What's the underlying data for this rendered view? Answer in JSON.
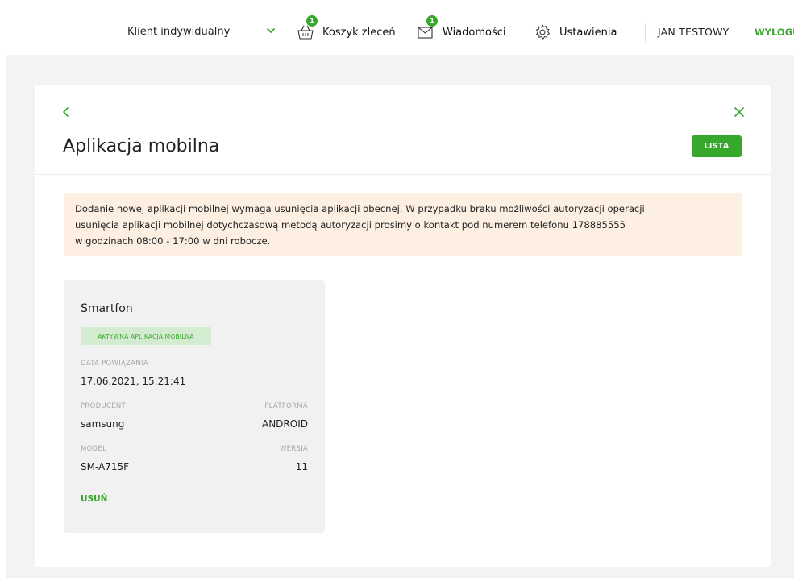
{
  "header": {
    "client_type": "Klient indywidualny",
    "basket_label": "Koszyk zleceń",
    "basket_count": "1",
    "messages_label": "Wiadomości",
    "messages_count": "1",
    "settings_label": "Ustawienia",
    "user_name": "JAN TESTOWY",
    "logout_label": "WYLOGUJ"
  },
  "page": {
    "title": "Aplikacja mobilna",
    "list_button": "LISTA",
    "notice_lines": [
      "Dodanie nowej aplikacji mobilnej wymaga usunięcia aplikacji obecnej. W przypadku braku możliwości autoryzacji operacji",
      "usunięcia aplikacji mobilnej dotychczasową metodą autoryzacji prosimy o kontakt pod numerem telefonu 178885555",
      "w godzinach 08:00 - 17:00 w dni robocze."
    ]
  },
  "device": {
    "name": "Smartfon",
    "status": "AKTYWNA APLIKACJA MOBILNA",
    "link_date_label": "DATA POWIĄZANIA",
    "link_date": "17.06.2021, 15:21:41",
    "producer_label": "PRODUCENT",
    "producer": "samsung",
    "platform_label": "PLATFORMA",
    "platform": "ANDROID",
    "model_label": "MODEL",
    "model": "SM-A715F",
    "version_label": "WERSJA",
    "version": "11",
    "remove_label": "USUŃ"
  },
  "colors": {
    "accent": "#38a82c",
    "notice_bg": "#fdf0e2",
    "badge_bg": "#d3ecd1",
    "card_bg": "#f1f1f1"
  }
}
